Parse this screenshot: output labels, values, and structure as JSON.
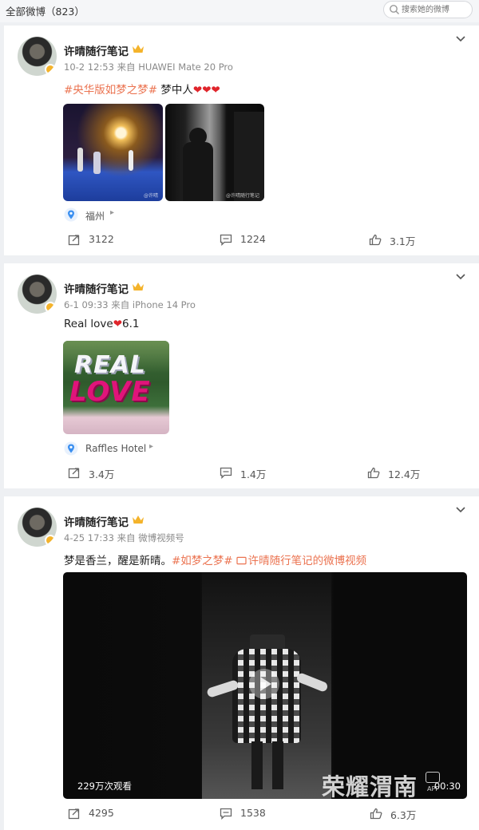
{
  "header": {
    "title": "全部微博（823）",
    "search_placeholder": "搜索她的微博"
  },
  "posts": [
    {
      "username": "许晴随行笔记",
      "time": "10-2 12:53",
      "via": "来自 HUAWEI Mate 20 Pro",
      "hashtag": "#央华版如梦之梦#",
      "text": " 梦中人",
      "hearts": "❤❤❤",
      "images": [
        "stage-performance-photo",
        "backstage-silhouette-photo"
      ],
      "image_watermarks": [
        "@许晴",
        "@许晴随行笔记"
      ],
      "location": "福州",
      "reposts": "3122",
      "comments": "1224",
      "likes": "3.1万"
    },
    {
      "username": "许晴随行笔记",
      "time": "6-1 09:33",
      "via": "来自 iPhone 14 Pro",
      "text_prefix": "Real love",
      "heart": "❤",
      "text_suffix": "6.1",
      "image_line1": "REAL",
      "image_line2": "LOVE",
      "location": "Raffles Hotel",
      "reposts": "3.4万",
      "comments": "1.4万",
      "likes": "12.4万"
    },
    {
      "username": "许晴随行笔记",
      "time": "4-25 17:33",
      "via": "来自 微博视频号",
      "text": "梦是香兰，醒是新晴。",
      "hashtag": "#如梦之梦#",
      "video_link": "许晴随行笔记的微博视频",
      "video_views": "229万次观看",
      "video_duration": "00:30",
      "watermark": "荣耀渭南",
      "watermark_sub": "APP",
      "reposts": "4295",
      "comments": "1538",
      "likes": "6.3万"
    }
  ],
  "colors": {
    "hashtag": "#eb7350",
    "page_bg": "#eef0f3",
    "location_pin": "#3b8ff0",
    "crown": "#f4b32b"
  }
}
